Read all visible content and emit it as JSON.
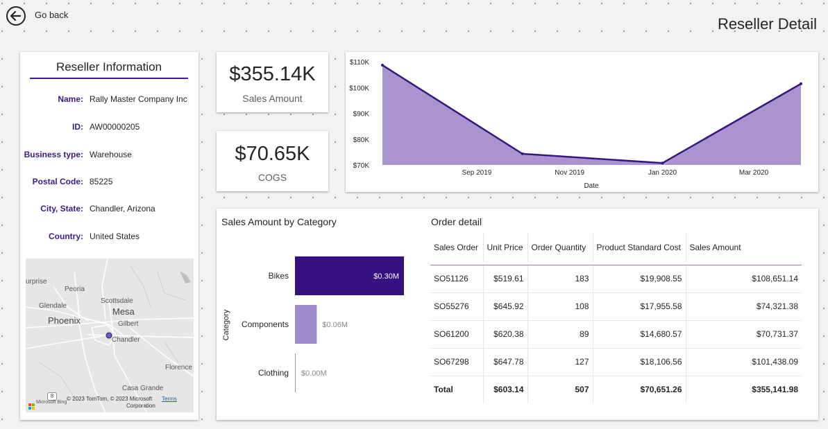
{
  "header": {
    "back_label": "Go back",
    "page_title": "Reseller Detail"
  },
  "reseller_info": {
    "title": "Reseller Information",
    "fields": [
      {
        "label": "Name:",
        "value": "Rally Master Company Inc"
      },
      {
        "label": "ID:",
        "value": "AW00000205"
      },
      {
        "label": "Business type:",
        "value": "Warehouse"
      },
      {
        "label": "Postal Code:",
        "value": "85225"
      },
      {
        "label": "City, State:",
        "value": "Chandler, Arizona"
      },
      {
        "label": "Country:",
        "value": "United States"
      }
    ]
  },
  "map": {
    "labels": {
      "surprise": "urprise",
      "peoria": "Peoria",
      "glendale": "Glendale",
      "phoenix": "Phoenix",
      "scottsdale": "Scottsdale",
      "mesa": "Mesa",
      "gilbert": "Gilbert",
      "chandler": "Chandler",
      "florence": "Florence",
      "casa_grande": "Casa Grande"
    },
    "highway_shield": "8",
    "brand": "Microsoft Bing",
    "copyright": "© 2023 TomTom, © 2023 Microsoft",
    "copyright_line2": "Corporation",
    "terms_label": "Terms"
  },
  "kpis": {
    "sales_amount": {
      "value": "$355.14K",
      "label": "Sales Amount"
    },
    "cogs": {
      "value": "$70.65K",
      "label": "COGS"
    }
  },
  "chart_data": [
    {
      "type": "area",
      "title": "",
      "xlabel": "Date",
      "ylabel": "",
      "x": [
        "2019-07-01",
        "2019-10-01",
        "2020-01-01",
        "2020-04-01"
      ],
      "series": [
        {
          "values": [
            108651.14,
            74321.38,
            70731.37,
            101438.09
          ]
        }
      ],
      "x_ticks": [
        "Sep 2019",
        "Nov 2019",
        "Jan 2020",
        "Mar 2020"
      ],
      "y_ticks": [
        "$70K",
        "$80K",
        "$90K",
        "$100K",
        "$110K"
      ],
      "ylim": [
        70000,
        110000
      ],
      "grid": false,
      "colors": {
        "fill": "#a994d0",
        "line": "#35177e"
      }
    },
    {
      "type": "bar",
      "orientation": "horizontal",
      "title": "Sales Amount by Category",
      "xlabel": "",
      "ylabel": "Category",
      "categories": [
        "Bikes",
        "Components",
        "Clothing"
      ],
      "values": [
        0.3,
        0.06,
        0.0
      ],
      "value_labels": [
        "$0.30M",
        "$0.06M",
        "$0.00M"
      ],
      "unit": "M",
      "colors": [
        "#35117f",
        "#a08ccb",
        "#a08ccb"
      ]
    }
  ],
  "order_detail": {
    "title": "Order detail",
    "columns": [
      "Sales Order",
      "Unit Price",
      "Order Quantity",
      "Product Standard Cost",
      "Sales Amount"
    ],
    "rows": [
      [
        "SO51126",
        "$519.61",
        "183",
        "$19,908.55",
        "$108,651.14"
      ],
      [
        "SO55276",
        "$645.92",
        "108",
        "$17,955.58",
        "$74,321.38"
      ],
      [
        "SO61200",
        "$620.38",
        "89",
        "$14,680.57",
        "$70,731.37"
      ],
      [
        "SO67298",
        "$647.78",
        "127",
        "$18,106.56",
        "$101,438.09"
      ]
    ],
    "total": [
      "Total",
      "$603.14",
      "507",
      "$70,651.26",
      "$355,141.98"
    ]
  },
  "colors": {
    "accent": "#3a1c82",
    "bar_primary": "#35117f",
    "bar_secondary": "#a08ccb",
    "area_fill": "#a994d0"
  }
}
